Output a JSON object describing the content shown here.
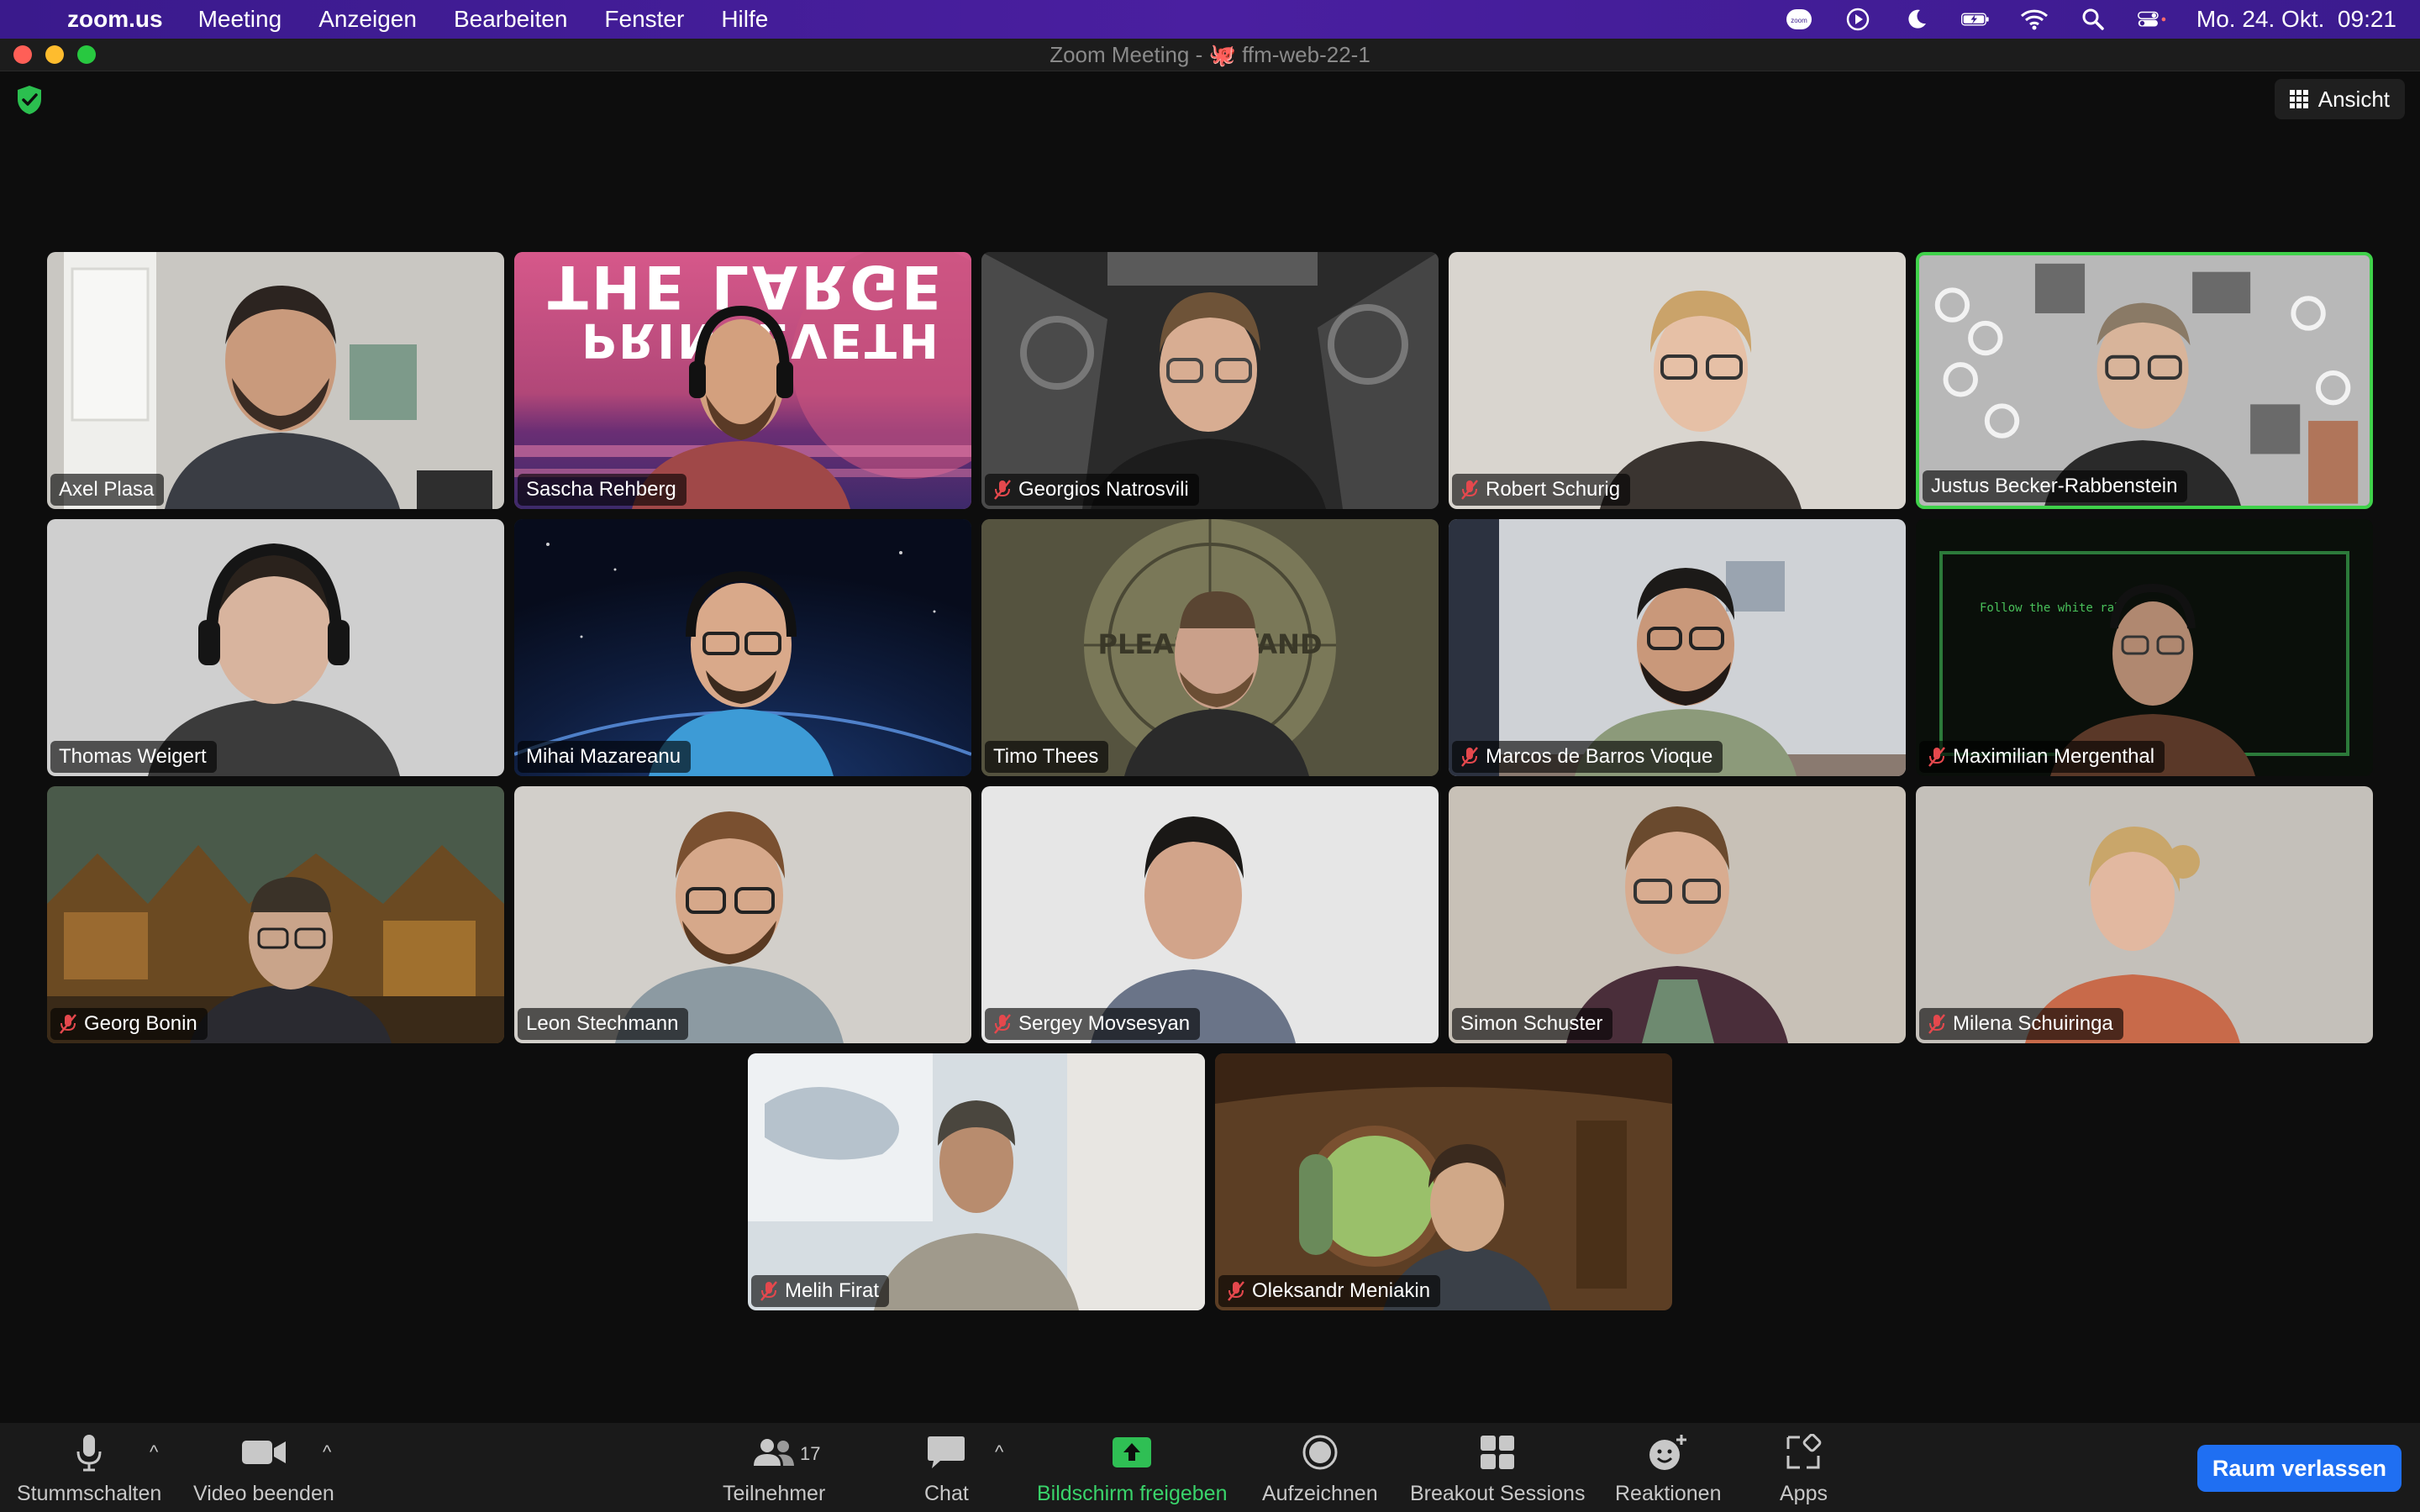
{
  "menubar": {
    "app": "zoom.us",
    "items": [
      "Meeting",
      "Anzeigen",
      "Bearbeiten",
      "Fenster",
      "Hilfe"
    ],
    "datetime": "Mo. 24. Okt.  09:21",
    "status_icons": [
      "zoom-status-icon",
      "play-icon",
      "moon-icon",
      "battery-icon",
      "wifi-icon",
      "search-icon",
      "control-center-icon"
    ]
  },
  "window": {
    "title": "Zoom Meeting - 🐙 ffm-web-22-1"
  },
  "header": {
    "view_label": "Ansicht"
  },
  "tiles": [
    {
      "name": "Axel Plasa",
      "muted": false,
      "active": false,
      "bg": "#c9c7c2"
    },
    {
      "name": "Sascha Rehberg",
      "muted": false,
      "active": false,
      "bg": "#b0456e"
    },
    {
      "name": "Georgios Natrosvili",
      "muted": true,
      "active": false,
      "bg": "#3b3b3b"
    },
    {
      "name": "Robert Schurig",
      "muted": true,
      "active": false,
      "bg": "#d9d5cf"
    },
    {
      "name": "Justus Becker-Rabbenstein",
      "muted": false,
      "active": true,
      "bg": "#9a9a9a"
    },
    {
      "name": "Thomas Weigert",
      "muted": false,
      "active": false,
      "bg": "#cfcfcf"
    },
    {
      "name": "Mihai Mazareanu",
      "muted": false,
      "active": false,
      "bg": "#142a55"
    },
    {
      "name": "Timo Thees",
      "muted": false,
      "active": false,
      "bg": "#5e5b45"
    },
    {
      "name": "Marcos de Barros Vioque",
      "muted": true,
      "active": false,
      "bg": "#cfd2d6"
    },
    {
      "name": "Maximilian Mergenthal",
      "muted": true,
      "active": false,
      "bg": "#0a0f0a"
    },
    {
      "name": "Georg Bonin",
      "muted": true,
      "active": false,
      "bg": "#5a4a2c"
    },
    {
      "name": "Leon Stechmann",
      "muted": false,
      "active": false,
      "bg": "#d2cfca"
    },
    {
      "name": "Sergey Movsesyan",
      "muted": true,
      "active": false,
      "bg": "#e6e6e6"
    },
    {
      "name": "Simon Schuster",
      "muted": false,
      "active": false,
      "bg": "#c8c1b7"
    },
    {
      "name": "Milena Schuiringa",
      "muted": true,
      "active": false,
      "bg": "#c4c0ba"
    },
    {
      "name": "Melih Firat",
      "muted": true,
      "active": false,
      "bg": "#d6dde2"
    },
    {
      "name": "Oleksandr Meniakin",
      "muted": true,
      "active": false,
      "bg": "#5c3e24"
    }
  ],
  "backgrounds": {
    "sascha_text": "THE LARGE",
    "sascha_text2": "PRINCEVETH",
    "timo_text": "PLEASE STAND BY",
    "max_text": "Follow the white rab"
  },
  "toolbar": {
    "mute": "Stummschalten",
    "video": "Video beenden",
    "participants": "Teilnehmer",
    "participants_count": "17",
    "chat": "Chat",
    "share": "Bildschirm freigeben",
    "record": "Aufzeichnen",
    "breakout": "Breakout Sessions",
    "reactions": "Reaktionen",
    "apps": "Apps",
    "leave": "Raum verlassen"
  },
  "colors": {
    "active_speaker_border": "#3fd14a",
    "share_green": "#39d36a",
    "leave_blue": "#1f6ff2",
    "muted_red": "#e5484d"
  }
}
